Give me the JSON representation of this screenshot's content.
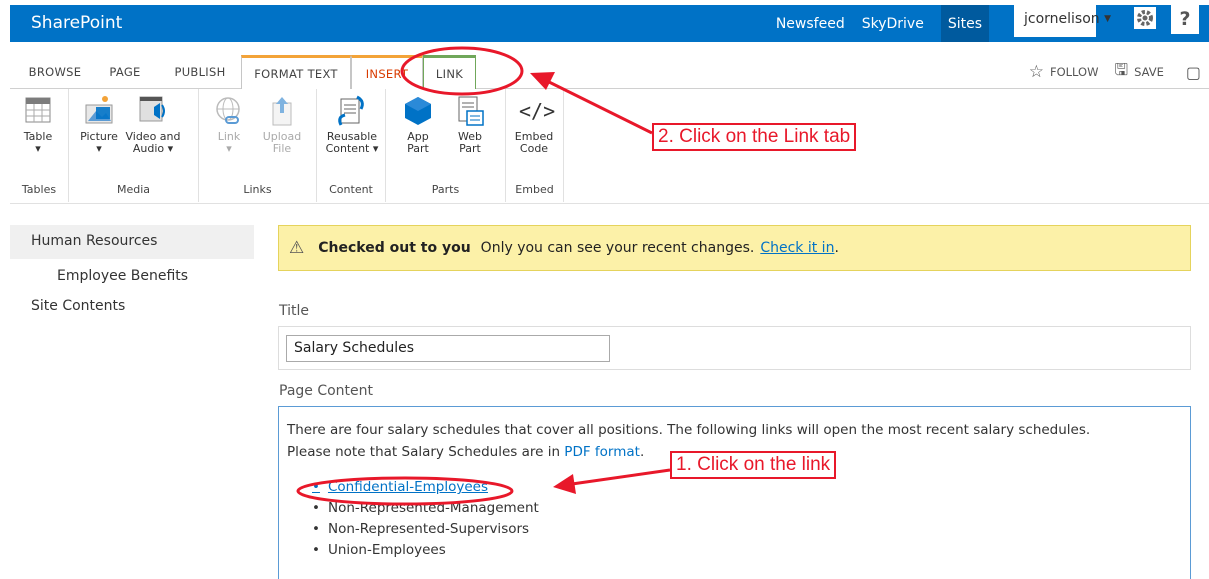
{
  "suite": {
    "brand": "SharePoint",
    "links": [
      "Newsfeed",
      "SkyDrive",
      "Sites"
    ],
    "user": "jcornelison",
    "help": "?"
  },
  "tabs": {
    "browse": "BROWSE",
    "page": "PAGE",
    "publish": "PUBLISH",
    "format_text": "FORMAT TEXT",
    "insert": "INSERT",
    "link": "LINK",
    "follow": "FOLLOW",
    "save": "SAVE"
  },
  "ribbon": {
    "groups": {
      "tables": "Tables",
      "media": "Media",
      "links": "Links",
      "content": "Content",
      "parts": "Parts",
      "embed": "Embed"
    },
    "buttons": {
      "table": "Table",
      "picture": "Picture",
      "video_audio": "Video and Audio",
      "link": "Link",
      "upload_file": "Upload File",
      "reusable_content": "Reusable Content",
      "app_part": "App Part",
      "web_part": "Web Part",
      "embed_code": "Embed Code"
    }
  },
  "leftnav": {
    "human_resources": "Human Resources",
    "employee_benefits": "Employee Benefits",
    "site_contents": "Site Contents"
  },
  "status": {
    "bold": "Checked out to you",
    "message": "Only you can see your recent changes.",
    "link": "Check it in",
    "end": "."
  },
  "form": {
    "title_label": "Title",
    "title_value": "Salary Schedules",
    "content_label": "Page Content",
    "paragraph1": "There are four salary schedules that cover all positions. The following links will open the most recent salary schedules.",
    "paragraph2_prefix": "Please note that Salary Schedules are in",
    "paragraph2_link": "PDF format",
    "paragraph2_suffix": ".",
    "list": [
      "Confidential-Employees",
      "Non-Represented-Management",
      "Non-Represented-Supervisors",
      "Union-Employees"
    ]
  },
  "annotations": {
    "step2": "2. Click on the Link tab",
    "step1": "1. Click on the link",
    "color": "#e8182a"
  }
}
